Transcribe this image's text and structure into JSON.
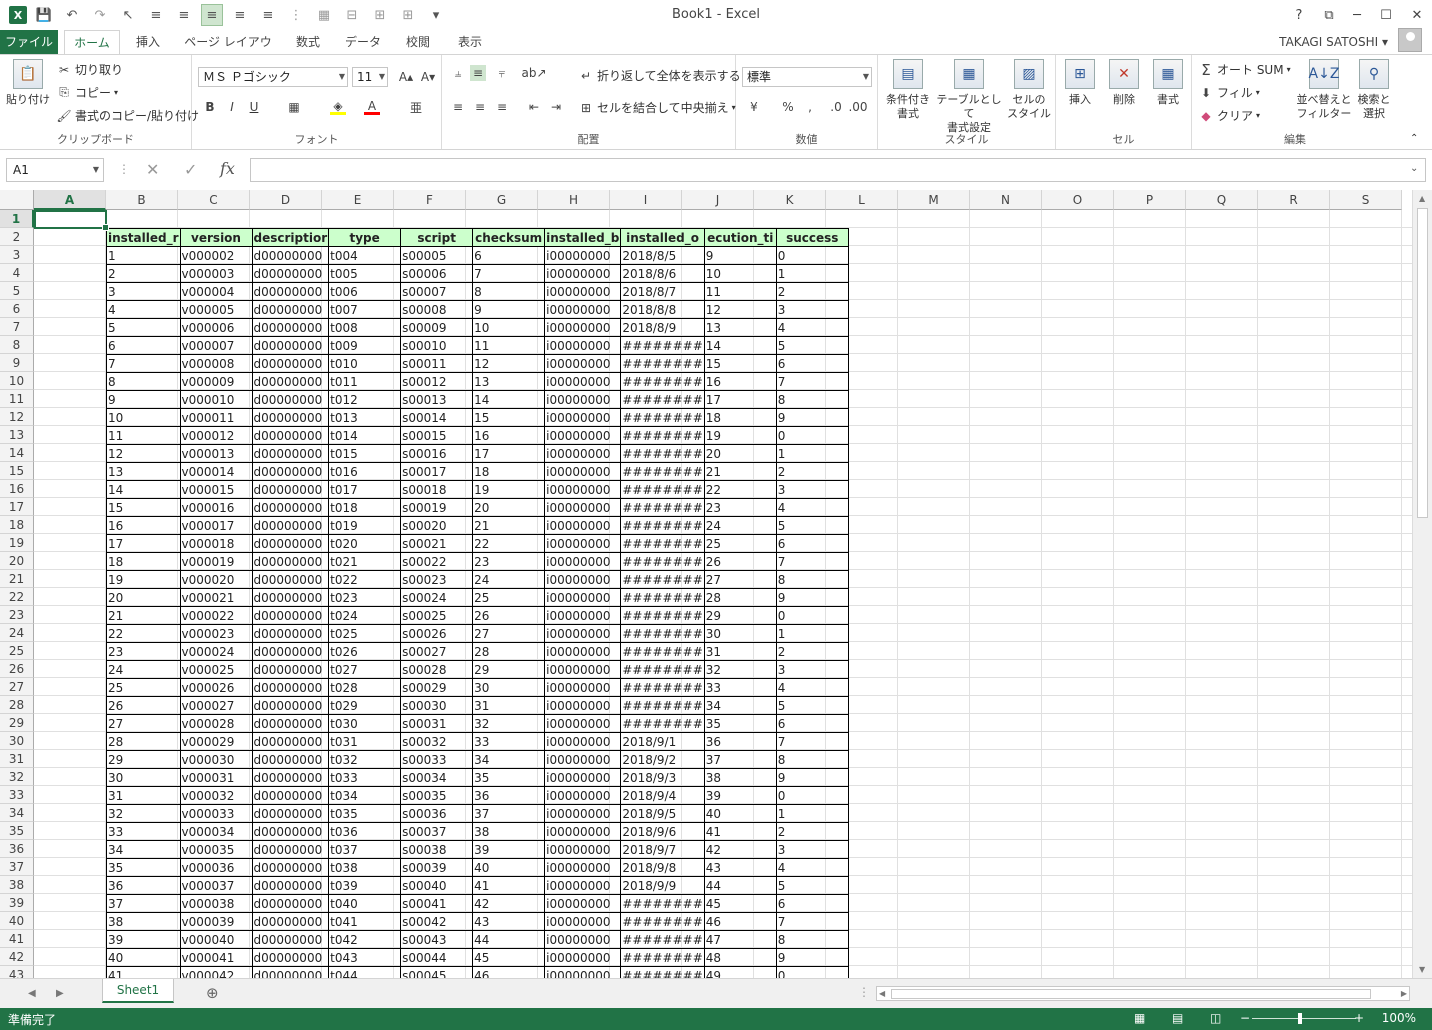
{
  "window": {
    "title": "Book1 - Excel",
    "help": "?",
    "min": "─",
    "max": "☐",
    "close": "✕",
    "restore": "⧉"
  },
  "tabs": [
    "ファイル",
    "ホーム",
    "挿入",
    "ページ レイアウト",
    "数式",
    "データ",
    "校閲",
    "表示"
  ],
  "user": {
    "name": "TAKAGI SATOSHI ▾"
  },
  "clipboard": {
    "paste": "貼り付け",
    "cut": "切り取り",
    "copy": "コピー",
    "format_copy": "書式のコピー/貼り付け",
    "label": "クリップボード"
  },
  "font": {
    "name": "ＭＳ Ｐゴシック",
    "size": "11",
    "label": "フォント"
  },
  "alignment": {
    "wrap": "折り返して全体を表示する",
    "merge": "セルを結合して中央揃え",
    "label": "配置"
  },
  "number": {
    "format": "標準",
    "label": "数値"
  },
  "styles": {
    "conditional": "条件付き\n書式",
    "as_table": "テーブルとして\n書式設定",
    "cell_styles": "セルの\nスタイル",
    "label": "スタイル"
  },
  "cells_group": {
    "insert": "挿入",
    "delete": "削除",
    "format": "書式",
    "label": "セル"
  },
  "editing": {
    "autosum": "オート SUM",
    "fill": "フィル",
    "clear": "クリア",
    "sort": "並べ替えと\nフィルター",
    "find": "検索と\n選択",
    "label": "編集"
  },
  "formula_bar": {
    "name_box": "A1",
    "fx": "fx",
    "value": ""
  },
  "columns": [
    "A",
    "B",
    "C",
    "D",
    "E",
    "F",
    "G",
    "H",
    "I",
    "J",
    "K",
    "L",
    "M",
    "N",
    "O",
    "P",
    "Q",
    "R",
    "S"
  ],
  "rows": [
    "1",
    "2",
    "3",
    "4",
    "5",
    "6",
    "7",
    "8",
    "9",
    "10",
    "11",
    "12",
    "13",
    "14",
    "15",
    "16",
    "17",
    "18",
    "19",
    "20",
    "21",
    "22",
    "23",
    "24",
    "25",
    "26",
    "27",
    "28",
    "29",
    "30",
    "31",
    "32",
    "33",
    "34",
    "35",
    "36",
    "37",
    "38",
    "39",
    "40",
    "41",
    "42",
    "43"
  ],
  "headers": [
    "installed_r",
    "version",
    "descriptior",
    "type",
    "script",
    "checksum",
    "installed_b",
    "installed_o",
    "ecution_ti",
    "success"
  ],
  "table_rows": [
    [
      "1",
      "v000002",
      "d00000000",
      "t004",
      "s00005",
      "6",
      "i00000000",
      "2018/8/5",
      "9",
      "0"
    ],
    [
      "2",
      "v000003",
      "d00000000",
      "t005",
      "s00006",
      "7",
      "i00000000",
      "2018/8/6",
      "10",
      "1"
    ],
    [
      "3",
      "v000004",
      "d00000000",
      "t006",
      "s00007",
      "8",
      "i00000000",
      "2018/8/7",
      "11",
      "2"
    ],
    [
      "4",
      "v000005",
      "d00000000",
      "t007",
      "s00008",
      "9",
      "i00000000",
      "2018/8/8",
      "12",
      "3"
    ],
    [
      "5",
      "v000006",
      "d00000000",
      "t008",
      "s00009",
      "10",
      "i00000000",
      "2018/8/9",
      "13",
      "4"
    ],
    [
      "6",
      "v000007",
      "d00000000",
      "t009",
      "s00010",
      "11",
      "i00000000",
      "########",
      "14",
      "5"
    ],
    [
      "7",
      "v000008",
      "d00000000",
      "t010",
      "s00011",
      "12",
      "i00000000",
      "########",
      "15",
      "6"
    ],
    [
      "8",
      "v000009",
      "d00000000",
      "t011",
      "s00012",
      "13",
      "i00000000",
      "########",
      "16",
      "7"
    ],
    [
      "9",
      "v000010",
      "d00000000",
      "t012",
      "s00013",
      "14",
      "i00000000",
      "########",
      "17",
      "8"
    ],
    [
      "10",
      "v000011",
      "d00000000",
      "t013",
      "s00014",
      "15",
      "i00000000",
      "########",
      "18",
      "9"
    ],
    [
      "11",
      "v000012",
      "d00000000",
      "t014",
      "s00015",
      "16",
      "i00000000",
      "########",
      "19",
      "0"
    ],
    [
      "12",
      "v000013",
      "d00000000",
      "t015",
      "s00016",
      "17",
      "i00000000",
      "########",
      "20",
      "1"
    ],
    [
      "13",
      "v000014",
      "d00000000",
      "t016",
      "s00017",
      "18",
      "i00000000",
      "########",
      "21",
      "2"
    ],
    [
      "14",
      "v000015",
      "d00000000",
      "t017",
      "s00018",
      "19",
      "i00000000",
      "########",
      "22",
      "3"
    ],
    [
      "15",
      "v000016",
      "d00000000",
      "t018",
      "s00019",
      "20",
      "i00000000",
      "########",
      "23",
      "4"
    ],
    [
      "16",
      "v000017",
      "d00000000",
      "t019",
      "s00020",
      "21",
      "i00000000",
      "########",
      "24",
      "5"
    ],
    [
      "17",
      "v000018",
      "d00000000",
      "t020",
      "s00021",
      "22",
      "i00000000",
      "########",
      "25",
      "6"
    ],
    [
      "18",
      "v000019",
      "d00000000",
      "t021",
      "s00022",
      "23",
      "i00000000",
      "########",
      "26",
      "7"
    ],
    [
      "19",
      "v000020",
      "d00000000",
      "t022",
      "s00023",
      "24",
      "i00000000",
      "########",
      "27",
      "8"
    ],
    [
      "20",
      "v000021",
      "d00000000",
      "t023",
      "s00024",
      "25",
      "i00000000",
      "########",
      "28",
      "9"
    ],
    [
      "21",
      "v000022",
      "d00000000",
      "t024",
      "s00025",
      "26",
      "i00000000",
      "########",
      "29",
      "0"
    ],
    [
      "22",
      "v000023",
      "d00000000",
      "t025",
      "s00026",
      "27",
      "i00000000",
      "########",
      "30",
      "1"
    ],
    [
      "23",
      "v000024",
      "d00000000",
      "t026",
      "s00027",
      "28",
      "i00000000",
      "########",
      "31",
      "2"
    ],
    [
      "24",
      "v000025",
      "d00000000",
      "t027",
      "s00028",
      "29",
      "i00000000",
      "########",
      "32",
      "3"
    ],
    [
      "25",
      "v000026",
      "d00000000",
      "t028",
      "s00029",
      "30",
      "i00000000",
      "########",
      "33",
      "4"
    ],
    [
      "26",
      "v000027",
      "d00000000",
      "t029",
      "s00030",
      "31",
      "i00000000",
      "########",
      "34",
      "5"
    ],
    [
      "27",
      "v000028",
      "d00000000",
      "t030",
      "s00031",
      "32",
      "i00000000",
      "########",
      "35",
      "6"
    ],
    [
      "28",
      "v000029",
      "d00000000",
      "t031",
      "s00032",
      "33",
      "i00000000",
      "2018/9/1",
      "36",
      "7"
    ],
    [
      "29",
      "v000030",
      "d00000000",
      "t032",
      "s00033",
      "34",
      "i00000000",
      "2018/9/2",
      "37",
      "8"
    ],
    [
      "30",
      "v000031",
      "d00000000",
      "t033",
      "s00034",
      "35",
      "i00000000",
      "2018/9/3",
      "38",
      "9"
    ],
    [
      "31",
      "v000032",
      "d00000000",
      "t034",
      "s00035",
      "36",
      "i00000000",
      "2018/9/4",
      "39",
      "0"
    ],
    [
      "32",
      "v000033",
      "d00000000",
      "t035",
      "s00036",
      "37",
      "i00000000",
      "2018/9/5",
      "40",
      "1"
    ],
    [
      "33",
      "v000034",
      "d00000000",
      "t036",
      "s00037",
      "38",
      "i00000000",
      "2018/9/6",
      "41",
      "2"
    ],
    [
      "34",
      "v000035",
      "d00000000",
      "t037",
      "s00038",
      "39",
      "i00000000",
      "2018/9/7",
      "42",
      "3"
    ],
    [
      "35",
      "v000036",
      "d00000000",
      "t038",
      "s00039",
      "40",
      "i00000000",
      "2018/9/8",
      "43",
      "4"
    ],
    [
      "36",
      "v000037",
      "d00000000",
      "t039",
      "s00040",
      "41",
      "i00000000",
      "2018/9/9",
      "44",
      "5"
    ],
    [
      "37",
      "v000038",
      "d00000000",
      "t040",
      "s00041",
      "42",
      "i00000000",
      "########",
      "45",
      "6"
    ],
    [
      "38",
      "v000039",
      "d00000000",
      "t041",
      "s00042",
      "43",
      "i00000000",
      "########",
      "46",
      "7"
    ],
    [
      "39",
      "v000040",
      "d00000000",
      "t042",
      "s00043",
      "44",
      "i00000000",
      "########",
      "47",
      "8"
    ],
    [
      "40",
      "v000041",
      "d00000000",
      "t043",
      "s00044",
      "45",
      "i00000000",
      "########",
      "48",
      "9"
    ],
    [
      "41",
      "v000042",
      "d00000000",
      "t044",
      "s00045",
      "46",
      "i00000000",
      "########",
      "49",
      "0"
    ]
  ],
  "sheet_tabs": {
    "active": "Sheet1",
    "add": "⊕"
  },
  "status": {
    "text": "準備完了",
    "zoom": "100%"
  },
  "colors": {
    "excel_green": "#217346",
    "header_fill": "#ccffcc"
  }
}
